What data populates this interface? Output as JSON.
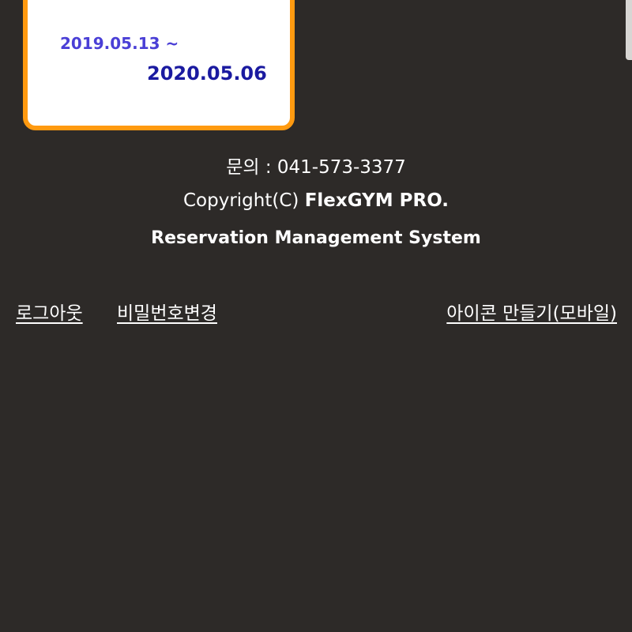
{
  "card": {
    "date_start": "2019.05.13 ~",
    "date_end": "2020.05.06",
    "border_color": "#ff9a10"
  },
  "footer": {
    "contact": "문의 : 041-573-3377",
    "copyright_prefix": "Copyright(C) ",
    "copyright_brand": "FlexGYM PRO.",
    "system_name": "Reservation Management System"
  },
  "links": {
    "logout": "로그아웃",
    "change_password": "비밀번호변경",
    "make_icon": "아이콘 만들기(모바일)"
  },
  "colors": {
    "background": "#2d2a28",
    "date_start": "#4a3fd6",
    "date_end": "#1a1aa0"
  }
}
